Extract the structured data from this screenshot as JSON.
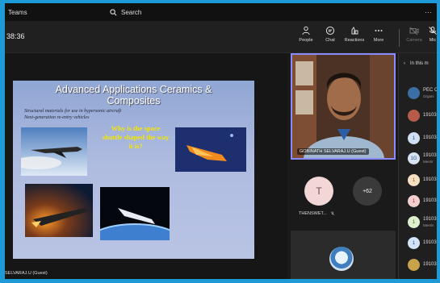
{
  "app": {
    "title": "Teams",
    "more": "…"
  },
  "search": {
    "placeholder": "Search"
  },
  "toolbar": {
    "timer": "38:36",
    "people": "People",
    "chat": "Chat",
    "reactions": "Reactions",
    "more": "More",
    "camera": "Camera",
    "mic": "Mic"
  },
  "slide": {
    "title_line1": "Advanced Applications Ceramics &",
    "title_line2": "Composites",
    "sub_line1": "Structural materials for use in hypersonic aircraft",
    "sub_line2": "Next-generation re-entry vehicles",
    "question": "Why is the space shuttle shaped the way it is?"
  },
  "stage": {
    "presenter_label": "SELVARAJ.U (Guest)"
  },
  "videos": {
    "main_name": "GOBINATH SELVARAJ.U (Guest)",
    "tile_initial": "T",
    "tile_name": "THENSWET...",
    "overflow_count": "+62"
  },
  "panel": {
    "title": "In this m",
    "rows": [
      {
        "initial": "",
        "name": "PEC O",
        "sub": "Organi",
        "color": "#3a6ea5",
        "fg": "#ffffff"
      },
      {
        "initial": "",
        "name": "19103",
        "sub": "",
        "color": "#b85b4a",
        "fg": "#ffffff"
      },
      {
        "initial": "1",
        "name": "19103",
        "sub": "",
        "color": "#cfe0f5",
        "fg": "#2b4c7e"
      },
      {
        "initial": "1G",
        "name": "19103",
        "sub": "Meetir",
        "color": "#d8e3f4",
        "fg": "#2b4c7e"
      },
      {
        "initial": "1",
        "name": "19103",
        "sub": "",
        "color": "#f7dfc1",
        "fg": "#8a5a1e"
      },
      {
        "initial": "1",
        "name": "19103",
        "sub": "",
        "color": "#f5cfcf",
        "fg": "#8a2e2e"
      },
      {
        "initial": "1",
        "name": "19103",
        "sub": "Meetin",
        "color": "#dff0d0",
        "fg": "#3e6a22"
      },
      {
        "initial": "1",
        "name": "19103",
        "sub": "",
        "color": "#d3e4f8",
        "fg": "#2b4c7e"
      },
      {
        "initial": "",
        "name": "19103",
        "sub": "",
        "color": "#c9a34a",
        "fg": "#ffffff"
      }
    ]
  }
}
